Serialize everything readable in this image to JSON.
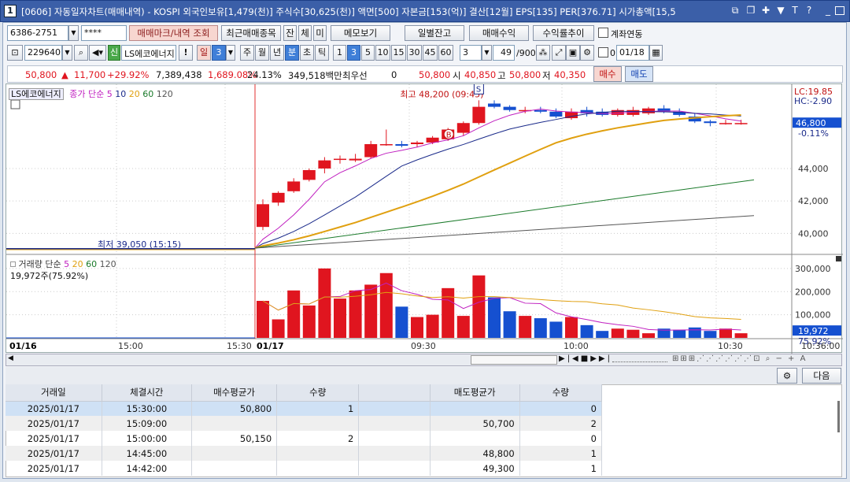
{
  "window": {
    "number": "1",
    "title": "[0606] 자동일자차트(매매내역) - KOSPI 외국인보유[1,479(천)] 주식수[30,625(천)] 액면[500] 자본금[153(억)] 결산[12월] EPS[135] PER[376.71] 시가총액[15,5"
  },
  "toolbar1": {
    "account": "6386-2751",
    "password": "****",
    "btn_mark": "매매마크/내역 조회",
    "btn_recent": "최근매매종목",
    "btn_jan": "잔",
    "btn_che": "체",
    "btn_mi": "미",
    "btn_memo": "메모보기",
    "btn_daily": "일별잔고",
    "btn_profit": "매매수익",
    "btn_trend": "수익률추이",
    "link_label": "계좌연동"
  },
  "toolbar2": {
    "code": "229640",
    "market_badge": "신",
    "stock_name": "LS에코에너지",
    "excl": "!",
    "period_day": "일",
    "period_num": "3",
    "weekly": "주",
    "monthly": "월",
    "yearly": "년",
    "minute": "분",
    "second": "초",
    "tick": "틱",
    "intervals": [
      "1",
      "3",
      "5",
      "10",
      "15",
      "30",
      "45",
      "60"
    ],
    "selected_interval": "3",
    "count": "49",
    "count_total": "/900",
    "date_prefix": "0",
    "date": "01/18"
  },
  "quote": {
    "price": "50,800",
    "arrow": "▲",
    "change": "11,700",
    "pct": "+29.92%",
    "volume": "7,389,438",
    "vol_pct": "1,689.08%",
    "turnover_pct": "24.13%",
    "amount": "349,518백만",
    "priority": "최우선",
    "zero": "0",
    "ask": "50,800",
    "open_label": "시",
    "open": "40,850",
    "high_label": "고",
    "high": "50,800",
    "low_label": "저",
    "low": "40,350",
    "buy": "매수",
    "sell": "매도"
  },
  "legend": {
    "stock": "LS에코에너지",
    "ma_label": "종가 단순",
    "ma": [
      "5",
      "10",
      "20",
      "60",
      "120"
    ],
    "vol_label": "거래량 단순",
    "vol_ma": [
      "5",
      "20",
      "60",
      "120"
    ],
    "vol_now": "19,972주(75.92%)"
  },
  "annot": {
    "high": "최고 48,200 (09:45)",
    "low": "최저 39,050 (15:15)",
    "B": "B",
    "S": "S"
  },
  "right_axis": {
    "lc": "LC:19.85",
    "hc": "HC:-2.90",
    "price_box": "46,800",
    "price_pct": "-0.11%",
    "ticks": [
      "44,000",
      "42,000",
      "40,000"
    ],
    "vol_ticks": [
      "300,000",
      "200,000",
      "100,000"
    ],
    "vol_box": "19,972",
    "vol_pct": "75.92%"
  },
  "x_axis": {
    "labels": [
      "01/16",
      "15:00",
      "15:30",
      "01/17",
      "09:30",
      "10:00",
      "10:30"
    ],
    "last": "10:36:00"
  },
  "table": {
    "headers": [
      "거래일",
      "체결시간",
      "매수평균가",
      "수량",
      "",
      "매도평균가",
      "수량"
    ],
    "rows": [
      [
        "2025/01/17",
        "15:30:00",
        "50,800",
        "1",
        "",
        "",
        "0"
      ],
      [
        "2025/01/17",
        "15:09:00",
        "",
        "",
        "",
        "50,700",
        "2"
      ],
      [
        "2025/01/17",
        "15:00:00",
        "50,150",
        "2",
        "",
        "",
        "0"
      ],
      [
        "2025/01/17",
        "14:45:00",
        "",
        "",
        "",
        "48,800",
        "1"
      ],
      [
        "2025/01/17",
        "14:42:00",
        "",
        "",
        "",
        "49,300",
        "1"
      ]
    ]
  },
  "next_button": "다음",
  "chart_data": {
    "type": "candlestick",
    "price_ylim": [
      39000,
      48800
    ],
    "candles": [
      {
        "o": 40400,
        "c": 41800,
        "h": 42100,
        "l": 40200
      },
      {
        "o": 41900,
        "c": 42500,
        "h": 42600,
        "l": 41700
      },
      {
        "o": 42600,
        "c": 43200,
        "h": 43400,
        "l": 42500
      },
      {
        "o": 43300,
        "c": 43900,
        "h": 44000,
        "l": 43200
      },
      {
        "o": 44000,
        "c": 44500,
        "h": 44700,
        "l": 43700
      },
      {
        "o": 44600,
        "c": 44600,
        "h": 44800,
        "l": 44300
      },
      {
        "o": 44500,
        "c": 44600,
        "h": 44900,
        "l": 44400
      },
      {
        "o": 44700,
        "c": 45500,
        "h": 45700,
        "l": 44600
      },
      {
        "o": 45500,
        "c": 45500,
        "h": 46400,
        "l": 45400
      },
      {
        "o": 45500,
        "c": 45400,
        "h": 45700,
        "l": 45300
      },
      {
        "o": 45500,
        "c": 45600,
        "h": 45700,
        "l": 45300
      },
      {
        "o": 45600,
        "c": 45900,
        "h": 46000,
        "l": 45500
      },
      {
        "o": 45800,
        "c": 46400,
        "h": 46500,
        "l": 45700
      },
      {
        "o": 46200,
        "c": 46800,
        "h": 46900,
        "l": 46000
      },
      {
        "o": 46800,
        "c": 47800,
        "h": 48200,
        "l": 46700
      },
      {
        "o": 48000,
        "c": 47800,
        "h": 48200,
        "l": 47700
      },
      {
        "o": 47800,
        "c": 47600,
        "h": 47900,
        "l": 47500
      },
      {
        "o": 47600,
        "c": 47600,
        "h": 47800,
        "l": 47400
      },
      {
        "o": 47600,
        "c": 47500,
        "h": 47800,
        "l": 47400
      },
      {
        "o": 47500,
        "c": 47200,
        "h": 47700,
        "l": 47100
      },
      {
        "o": 47100,
        "c": 47500,
        "h": 47700,
        "l": 47000
      },
      {
        "o": 47600,
        "c": 47400,
        "h": 47800,
        "l": 47200
      },
      {
        "o": 47500,
        "c": 47300,
        "h": 47700,
        "l": 47200
      },
      {
        "o": 47300,
        "c": 47600,
        "h": 47700,
        "l": 47200
      },
      {
        "o": 47300,
        "c": 47600,
        "h": 47800,
        "l": 47200
      },
      {
        "o": 47400,
        "c": 47700,
        "h": 47800,
        "l": 47300
      },
      {
        "o": 47700,
        "c": 47500,
        "h": 47900,
        "l": 47400
      },
      {
        "o": 47500,
        "c": 47300,
        "h": 47700,
        "l": 47200
      },
      {
        "o": 47200,
        "c": 46900,
        "h": 47400,
        "l": 46800
      },
      {
        "o": 46900,
        "c": 46800,
        "h": 47000,
        "l": 46600
      },
      {
        "o": 46800,
        "c": 46800,
        "h": 47000,
        "l": 46700
      },
      {
        "o": 46800,
        "c": 46800,
        "h": 47000,
        "l": 46700
      }
    ],
    "volume": [
      160000,
      80000,
      205000,
      140000,
      300000,
      170000,
      205000,
      230000,
      280000,
      135000,
      90000,
      100000,
      215000,
      95000,
      270000,
      175000,
      115000,
      95000,
      85000,
      70000,
      90000,
      55000,
      30000,
      40000,
      35000,
      20000,
      40000,
      35000,
      45000,
      30000,
      40000,
      19972
    ],
    "volume_ylim": [
      0,
      320000
    ]
  }
}
